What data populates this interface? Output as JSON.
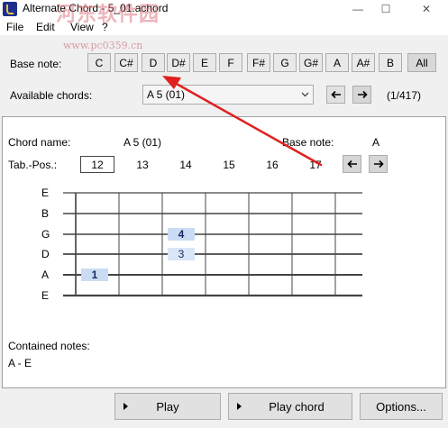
{
  "window": {
    "title": "Alternate Chord - 5_01.achord",
    "minimize_icon": "—",
    "maximize_icon": "☐",
    "close_icon": "✕"
  },
  "menu": [
    "File",
    "Edit",
    "View",
    "?"
  ],
  "watermark": {
    "text": "河东软件园",
    "url": "www.pc0359.cn"
  },
  "base_note_bar": {
    "label": "Base note:",
    "notes": [
      "C",
      "C#",
      "D",
      "D#",
      "E",
      "F",
      "F#",
      "G",
      "G#",
      "A",
      "A#",
      "B"
    ],
    "all_label": "All"
  },
  "chords": {
    "label": "Available chords:",
    "selected": "A 5 (01)",
    "counter": "(1/417)"
  },
  "detail": {
    "chord_name_label": "Chord name:",
    "chord_name": "A 5 (01)",
    "base_note_label": "Base note:",
    "base_note": "A",
    "tab_pos_label": "Tab.-Pos.:",
    "selected_pos": "12",
    "positions": [
      "13",
      "14",
      "15",
      "16",
      "17"
    ]
  },
  "fretboard": {
    "strings": [
      "E",
      "B",
      "G",
      "D",
      "A",
      "E"
    ],
    "fingerings": [
      {
        "string": "G",
        "fret": 14,
        "finger": "4"
      },
      {
        "string": "D",
        "fret": 14,
        "finger": "3"
      },
      {
        "string": "A",
        "fret": 12,
        "finger": "1"
      }
    ]
  },
  "contained_notes": {
    "label": "Contained notes:",
    "value": "A - E"
  },
  "buttons": {
    "play": "Play",
    "play_chord": "Play chord",
    "options": "Options..."
  },
  "colors": {
    "finger_highlight": "#c9dcf3",
    "annotation_arrow": "#e02020"
  }
}
